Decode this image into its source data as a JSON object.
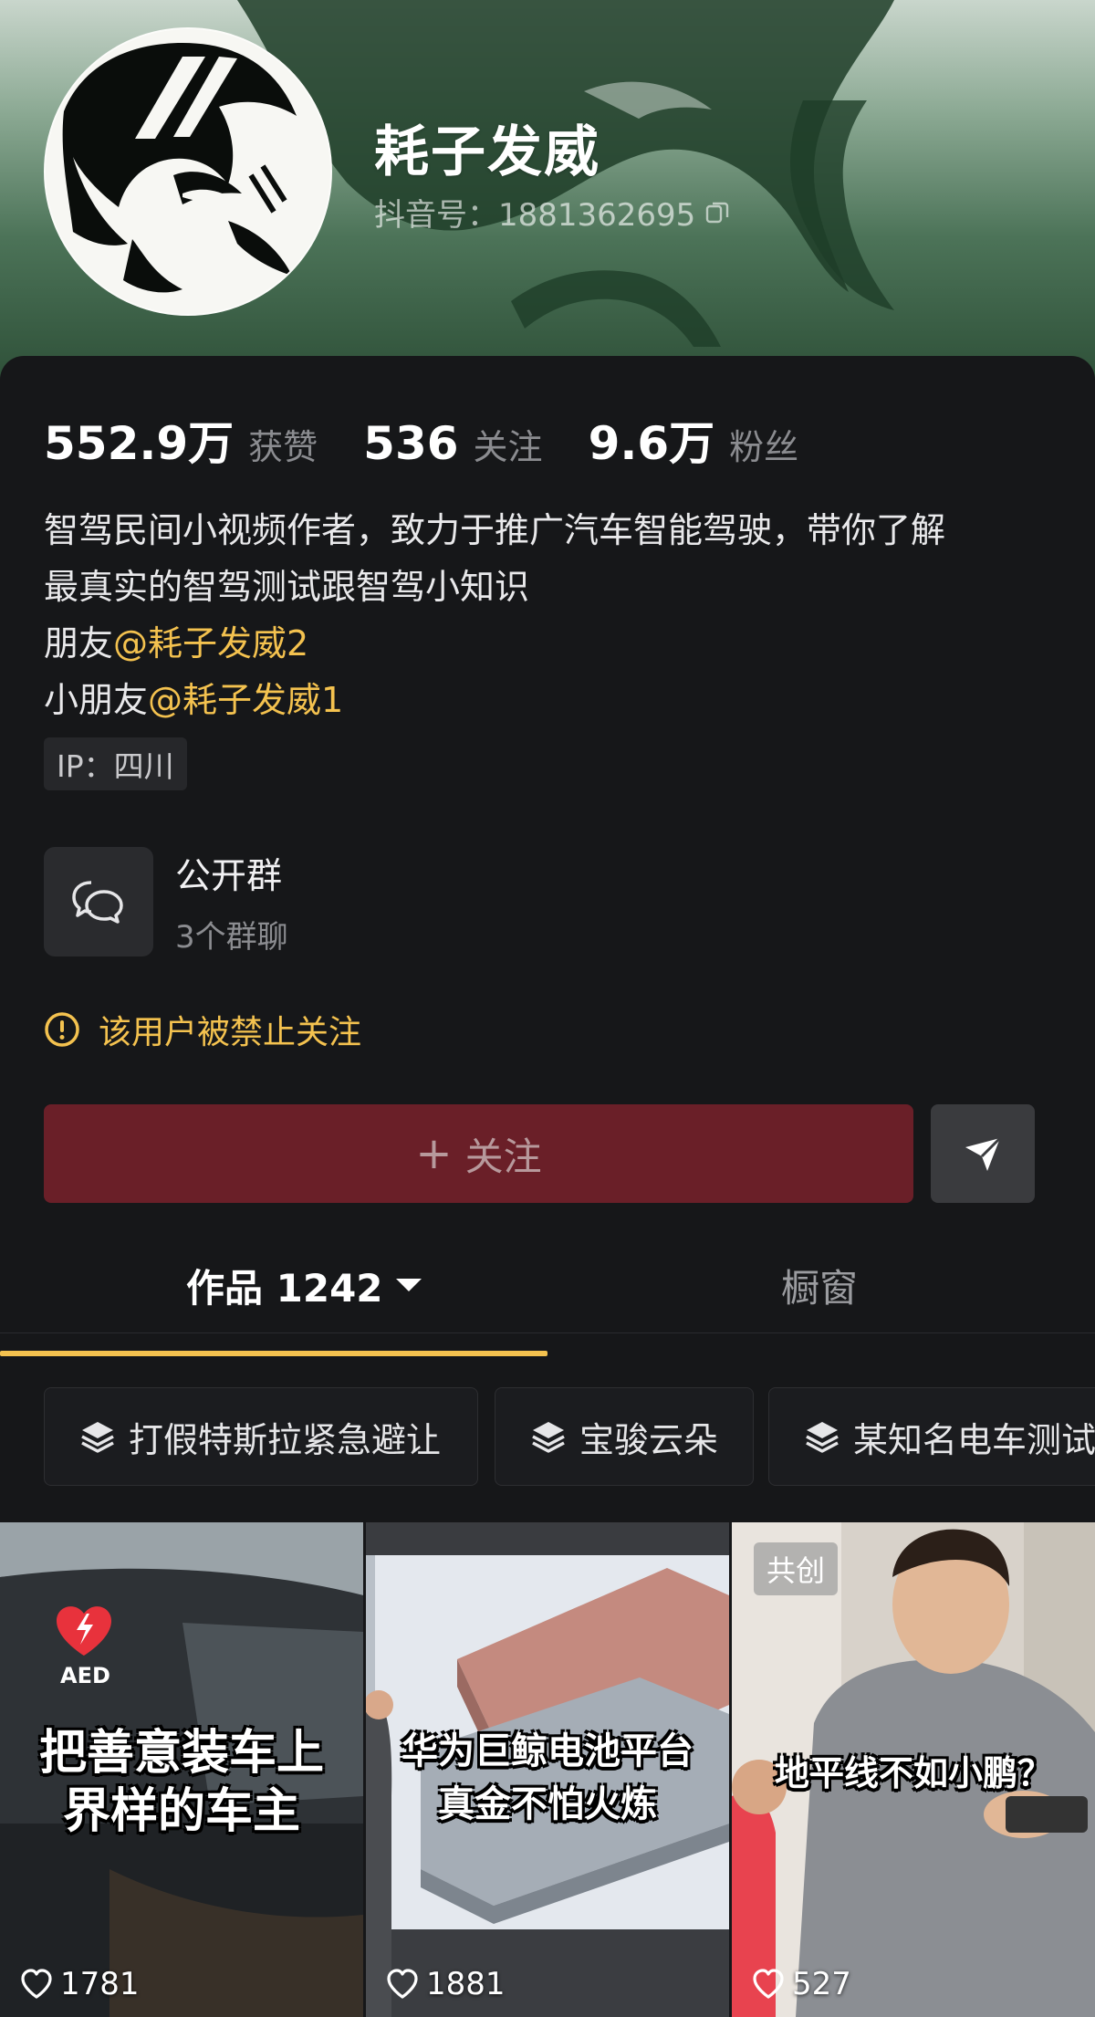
{
  "profile": {
    "nickname": "耗子发威",
    "douyin_id": "抖音号：1881362695"
  },
  "stats": [
    {
      "value": "552.9万",
      "label": "获赞"
    },
    {
      "value": "536",
      "label": "关注"
    },
    {
      "value": "9.6万",
      "label": "粉丝"
    }
  ],
  "bio": {
    "line1": "智驾民间小视频作者，致力于推广汽车智能驾驶，带你了解",
    "line2": "最真实的智驾测试跟智驾小知识",
    "friend_prefix": "朋友",
    "friend_mention": "@耗子发威2",
    "kid_prefix": "小朋友",
    "kid_mention": "@耗子发威1"
  },
  "ip": "IP：四川",
  "group": {
    "title": "公开群",
    "subtitle": "3个群聊"
  },
  "warning": "该用户被禁止关注",
  "follow_button": {
    "plus": "+",
    "label": "关注"
  },
  "tabs": {
    "works": "作品 1242",
    "window": "橱窗"
  },
  "collections": [
    "打假特斯拉紧急避让",
    "宝骏云朵",
    "某知名电车测试"
  ],
  "videos": [
    {
      "title_line1": "把善意装车上",
      "title_line2": "界样的车主",
      "badge": "AED",
      "likes": "1781"
    },
    {
      "title_line1": "华为巨鲸电池平台",
      "title_line2": "真金不怕火炼",
      "likes": "1881"
    },
    {
      "title_line1": "地平线不如小鹏？",
      "cocreate": "共创",
      "likes": "527"
    }
  ],
  "colors": {
    "accent_yellow": "#f4c24f",
    "follow_button_bg": "#6a1f28",
    "page_bg": "#161719"
  }
}
